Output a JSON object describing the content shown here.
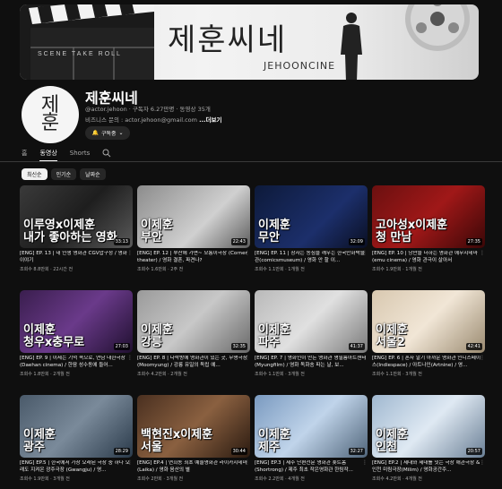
{
  "banner": {
    "title": "제훈씨네",
    "subtitle": "JEHOONCINE",
    "clapper_text": "SCENE   TAKE   ROLL"
  },
  "channel": {
    "avatar_text": "제\n훈",
    "name": "제훈씨네",
    "meta": "@actor.jehoon · 구독자 6.27만명 · 동영상 35개",
    "desc": "비즈니스 문의 : actor.jehoon@gmail.com",
    "more": "...더보기",
    "subscribe_label": "구독중"
  },
  "tabs": [
    "홈",
    "동영상",
    "Shorts"
  ],
  "active_tab": "동영상",
  "chips": [
    "최신순",
    "인기순",
    "날짜순"
  ],
  "videos": [
    {
      "thumb_text": "이루영x이제훈\n내가 좋아하는 영화",
      "duration": "33:13",
      "title": "[ENG] EP. 13 | 내 인생 영화관 CGV압구정 / 영화 이야기",
      "meta": "조회수 8.8만회 · 22시간 전"
    },
    {
      "thumb_text": "이제훈\n부안",
      "duration": "22:43",
      "title": "[ENG] EP. 12 | 부산에 가면~ 모퉁이극장 (Corner theater) / 영화 결혼, 파견나?",
      "meta": "조회수 1.6만회 · 2주 전"
    },
    {
      "thumb_text": "이제훈\n무안",
      "duration": "32:09",
      "title": "[ENG] EP. 11 | 장자는 동심을 깨우는 한국만화박물관(comicsmuseum) / 영화 안 할 이...",
      "meta": "조회수 1.1만회 · 1개월 전"
    },
    {
      "thumb_text": "고아성x이제훈\n청 만남",
      "duration": "27:35",
      "title": "[ENG] EP. 10 | 낭만을 더하는 영화관 에무시네마(emu cinema) / 영화 관극이 살아서",
      "meta": "조회수 1.9만회 · 1개월 전"
    },
    {
      "thumb_text": "이제훈\n청우x충무로",
      "duration": "27:03",
      "title": "[ENG] EP. 9 | 이제는 기억 속으로, 연남 대한극장(Daehan cinema) / 한땀 성수동에 들어...",
      "meta": "조회수 1.8만회 · 2개월 전"
    },
    {
      "thumb_text": "이제훈\n강릉",
      "duration": "32:35",
      "title": "[ENG] EP. 8 | 다락방에 영화관이 있는 곳, 무명극장(Moomyung) / 강릉 유일의 독립 예...",
      "meta": "조회수 4.2만회 · 2개월 전"
    },
    {
      "thumb_text": "이제훈\n파주",
      "duration": "41:37",
      "title": "[ENG] EP. 7 | 영화인이 만든 영화관 명필름아트센터(Myungfilm) / 영화 독화송 파는 날, 보...",
      "meta": "조회수 1.1만회 · 3개월 전"
    },
    {
      "thumb_text": "이제훈\n서울2",
      "duration": "42:41",
      "title": "[ENG] EP. 6 | 혼자 알기 아까운 영화관 인디스페이스(Indiespace) / 아트나인(Artnine) / 영...",
      "meta": "조회수 1.1만회 · 3개월 전"
    },
    {
      "thumb_text": "이제훈\n광주",
      "duration": "28:29",
      "title": "[ENG] EP.5 | 한국에서 가장 오래된 극장 중 하나 오래도 지켜온 광주극장 (Gwangju) / 영...",
      "meta": "조회수 1.9만회 · 3개월 전"
    },
    {
      "thumb_text": "백현진x이제훈\n서울",
      "duration": "30:44",
      "title": "[ENG] EP.4 | 연희동 최초 예술영화관 라이카시네마 (Laika) / 영화 음산의 별",
      "meta": "조회수 2만회 · 3개월 전"
    },
    {
      "thumb_text": "이제훈\n제주",
      "duration": "32:27",
      "title": "[ENG] EP.3 | 제주 단편전문 영화관 숏트폼 (Shortrong) / 제주 최초 작은영화관 한림작...",
      "meta": "조회수 2.2만회 · 4개월 전"
    },
    {
      "thumb_text": "이제훈\n인천",
      "duration": "20:57",
      "title": "[ENG] EP.2 | 세대와 세대를 잇는 극장 애관극장 & 인천 미림극장(Milim) / 영화공간주...",
      "meta": "조회수 4.2만회 · 4개월 전"
    }
  ],
  "colors": {
    "bg": "#0f0f0f",
    "chip_active": "#f1f1f1",
    "meta": "#aaaaaa"
  }
}
